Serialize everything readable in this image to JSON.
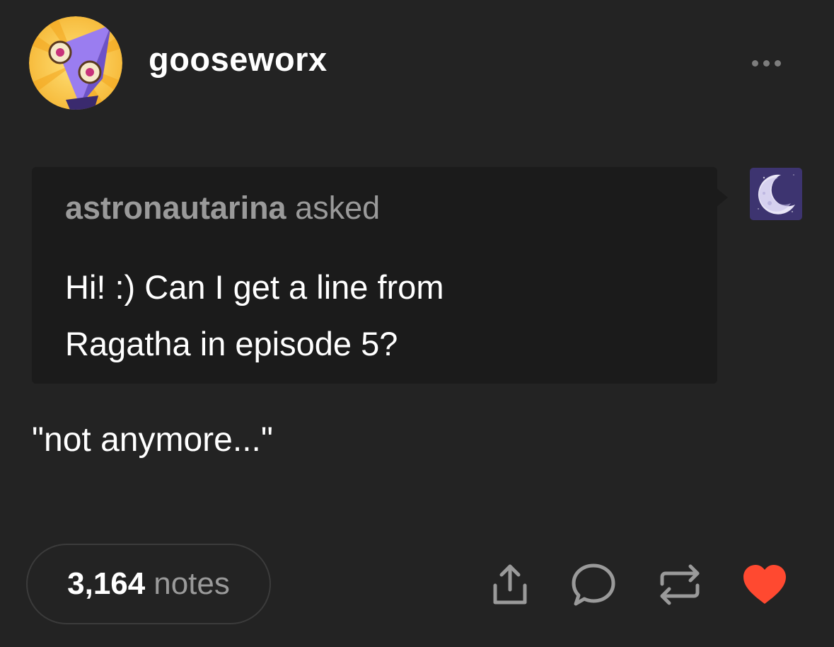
{
  "post": {
    "blog_name": "gooseworx",
    "ask": {
      "asker": "astronautarina",
      "asked_label": "asked",
      "question_line1": "Hi! :) Can I get a line from",
      "question_line2": "Ragatha in episode 5?"
    },
    "answer": "\"not anymore...\"",
    "notes": {
      "count": "3,164",
      "label": "notes"
    }
  },
  "colors": {
    "background": "#232323",
    "ask_background": "#1b1b1b",
    "muted_text": "#9a9a9a",
    "icon_gray": "#9a9a9a",
    "like_red": "#ff4930"
  },
  "icons": {
    "more": "more-dots-icon",
    "share": "share-icon",
    "reply": "reply-bubble-icon",
    "reblog": "reblog-icon",
    "like": "heart-icon"
  }
}
